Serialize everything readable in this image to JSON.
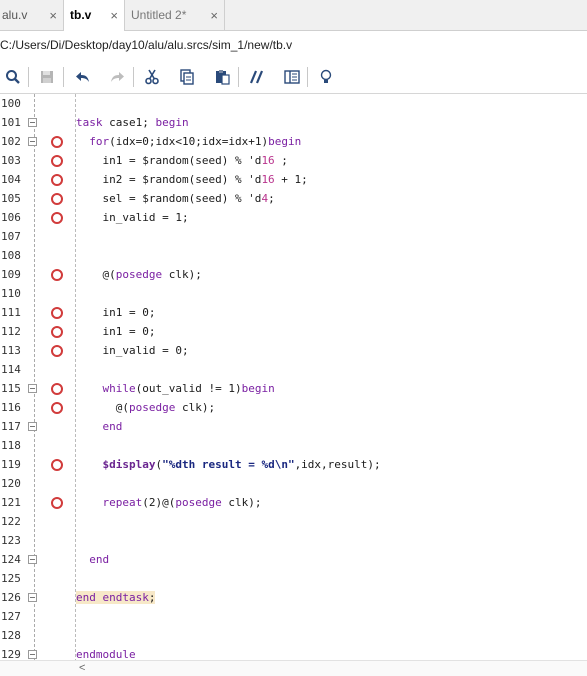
{
  "tabs": [
    {
      "label": "alu.v",
      "close": "×"
    },
    {
      "label": "tb.v",
      "close": "×"
    },
    {
      "label": "Untitled 2*",
      "close": "×"
    }
  ],
  "file_path": "C:/Users/Di/Desktop/day10/alu/alu.srcs/sim_1/new/tb.v",
  "toolbar": [
    {
      "name": "search-icon"
    },
    {
      "name": "save-icon"
    },
    {
      "name": "undo-icon"
    },
    {
      "name": "redo-icon"
    },
    {
      "name": "cut-icon"
    },
    {
      "name": "copy-icon"
    },
    {
      "name": "paste-icon"
    },
    {
      "name": "comment-icon"
    },
    {
      "name": "columns-icon"
    },
    {
      "name": "lightbulb-icon"
    }
  ],
  "colors": {
    "breakpoint": "#d13b3b",
    "keyword": "#7a1fa2",
    "number": "#b8328c",
    "highlight": "#f7e8c8"
  },
  "lines": [
    {
      "n": "100",
      "code": "",
      "bp": false,
      "fold": false
    },
    {
      "n": "101",
      "code": "task case1; begin",
      "bp": false,
      "fold": true
    },
    {
      "n": "102",
      "code": "  for(idx=0;idx<10;idx=idx+1)begin",
      "bp": true,
      "fold": true
    },
    {
      "n": "103",
      "code": "    in1 = $random(seed) % 'd16 ;",
      "bp": true,
      "fold": false
    },
    {
      "n": "104",
      "code": "    in2 = $random(seed) % 'd16 + 1;",
      "bp": true,
      "fold": false
    },
    {
      "n": "105",
      "code": "    sel = $random(seed) % 'd4;",
      "bp": true,
      "fold": false
    },
    {
      "n": "106",
      "code": "    in_valid = 1;",
      "bp": true,
      "fold": false
    },
    {
      "n": "107",
      "code": "",
      "bp": false,
      "fold": false
    },
    {
      "n": "108",
      "code": "",
      "bp": false,
      "fold": false
    },
    {
      "n": "109",
      "code": "    @(posedge clk);",
      "bp": true,
      "fold": false
    },
    {
      "n": "110",
      "code": "",
      "bp": false,
      "fold": false
    },
    {
      "n": "111",
      "code": "    in1 = 0;",
      "bp": true,
      "fold": false
    },
    {
      "n": "112",
      "code": "    in1 = 0;",
      "bp": true,
      "fold": false
    },
    {
      "n": "113",
      "code": "    in_valid = 0;",
      "bp": true,
      "fold": false
    },
    {
      "n": "114",
      "code": "",
      "bp": false,
      "fold": false
    },
    {
      "n": "115",
      "code": "    while(out_valid != 1)begin",
      "bp": true,
      "fold": true
    },
    {
      "n": "116",
      "code": "      @(posedge clk);",
      "bp": true,
      "fold": false
    },
    {
      "n": "117",
      "code": "    end",
      "bp": false,
      "fold": true
    },
    {
      "n": "118",
      "code": "",
      "bp": false,
      "fold": false
    },
    {
      "n": "119",
      "code": "    $display(\"%dth result = %d\\n\",idx,result);",
      "bp": true,
      "fold": false
    },
    {
      "n": "120",
      "code": "",
      "bp": false,
      "fold": false
    },
    {
      "n": "121",
      "code": "    repeat(2)@(posedge clk);",
      "bp": true,
      "fold": false
    },
    {
      "n": "122",
      "code": "",
      "bp": false,
      "fold": false
    },
    {
      "n": "123",
      "code": "",
      "bp": false,
      "fold": false
    },
    {
      "n": "124",
      "code": "  end",
      "bp": false,
      "fold": true
    },
    {
      "n": "125",
      "code": "",
      "bp": false,
      "fold": false
    },
    {
      "n": "126",
      "code": "end endtask;",
      "bp": false,
      "fold": true,
      "highlight": true
    },
    {
      "n": "127",
      "code": "",
      "bp": false,
      "fold": false
    },
    {
      "n": "128",
      "code": "",
      "bp": false,
      "fold": false
    },
    {
      "n": "129",
      "code": "endmodule",
      "bp": false,
      "fold": true
    }
  ],
  "scroll_arrow": "<"
}
